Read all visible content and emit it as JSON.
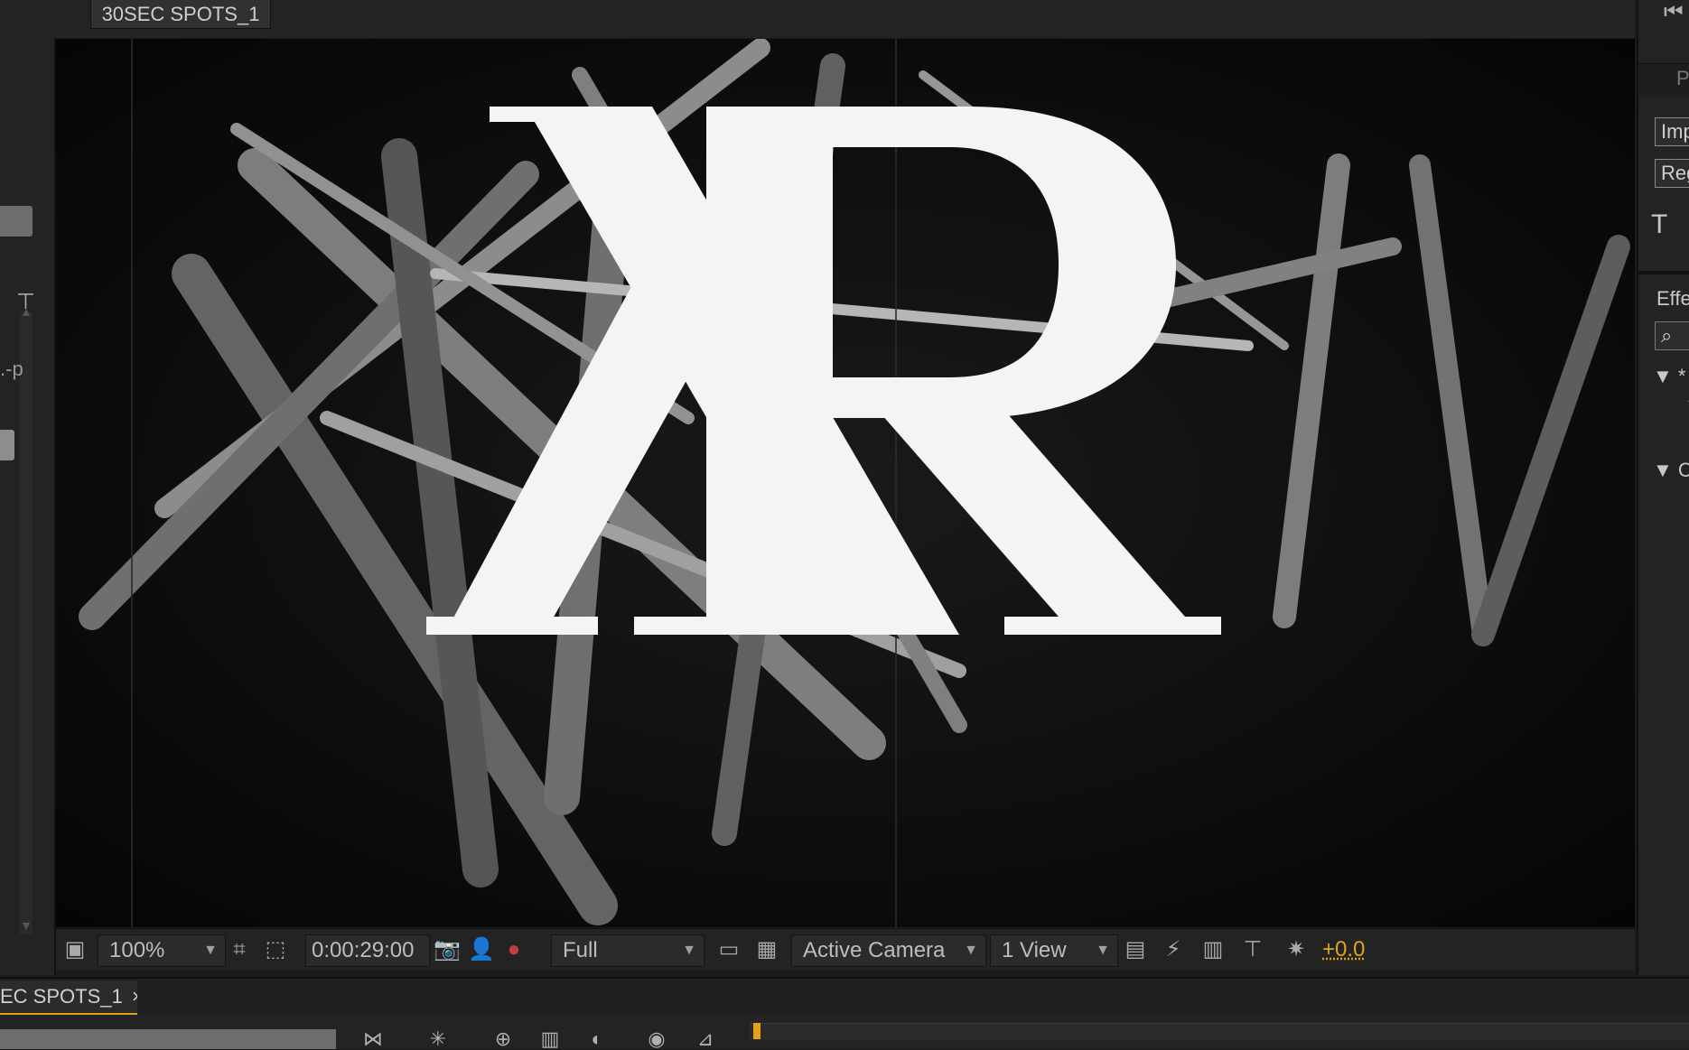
{
  "viewer": {
    "tab_label": "30SEC SPOTS_1",
    "artwork": {
      "logo_text": "XR",
      "side_text": "TV"
    }
  },
  "viewer_toolbar": {
    "zoom": "100%",
    "timecode": "0:00:29:00",
    "resolution": "Full",
    "camera": "Active Camera",
    "view_layout": "1 View",
    "exposure": "+0.0",
    "icons": [
      "always-preview-icon",
      "region-of-interest-icon",
      "transparency-grid-toggle-icon",
      "snapshot-camera-icon",
      "show-snapshot-icon",
      "color-channels-icon",
      "fast-preview-icon",
      "toggle-transparency-grid-icon",
      "3d-view-icon",
      "flowchart-icon",
      "reset-exposure-icon"
    ]
  },
  "right_panel": {
    "paragraph_tab": "P",
    "field_1": "Imp",
    "field_2": "Reg",
    "effects_label": "Effe",
    "group_1": "* A",
    "group_2": "Ch"
  },
  "timeline": {
    "tab_label": "EC SPOTS_1",
    "close_glyph": "×"
  },
  "colors": {
    "accent": "#e3a21a",
    "panel_bg": "#232323",
    "viewer_bg": "#080808"
  }
}
